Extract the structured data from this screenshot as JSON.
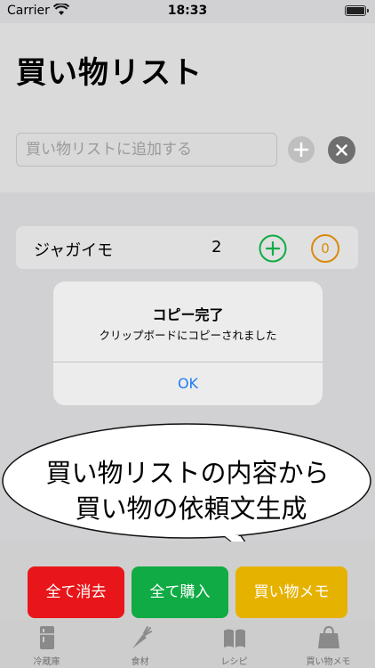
{
  "status_bar": {
    "carrier": "Carrier",
    "time": "18:33"
  },
  "header": {
    "title": "買い物リスト",
    "input_placeholder": "買い物リストに追加する",
    "add_icon": "plus-circle-icon",
    "clear_icon": "close-circle-icon"
  },
  "list": {
    "items": [
      {
        "name": "ジャガイモ",
        "quantity": "2",
        "counter_badge": "0"
      }
    ]
  },
  "alert": {
    "title": "コピー完了",
    "message": "クリップボードにコピーされました",
    "ok_label": "OK"
  },
  "callout": {
    "line1": "買い物リストの内容から",
    "line2": "買い物の依頼文生成"
  },
  "actions": {
    "clear_all": "全て消去",
    "buy_all": "全て購入",
    "memo": "買い物メモ"
  },
  "tabs": [
    {
      "label": "冷蔵庫",
      "icon": "refrigerator-icon"
    },
    {
      "label": "食材",
      "icon": "carrot-icon"
    },
    {
      "label": "レシピ",
      "icon": "book-icon"
    },
    {
      "label": "買い物メモ",
      "icon": "shopping-bag-icon"
    }
  ],
  "colors": {
    "clear_all": "#e8161a",
    "buy_all": "#10ab45",
    "memo": "#e6b200",
    "plus_green": "#10ab45",
    "badge_orange": "#d98a0a",
    "alert_ok": "#1e7cf2"
  }
}
